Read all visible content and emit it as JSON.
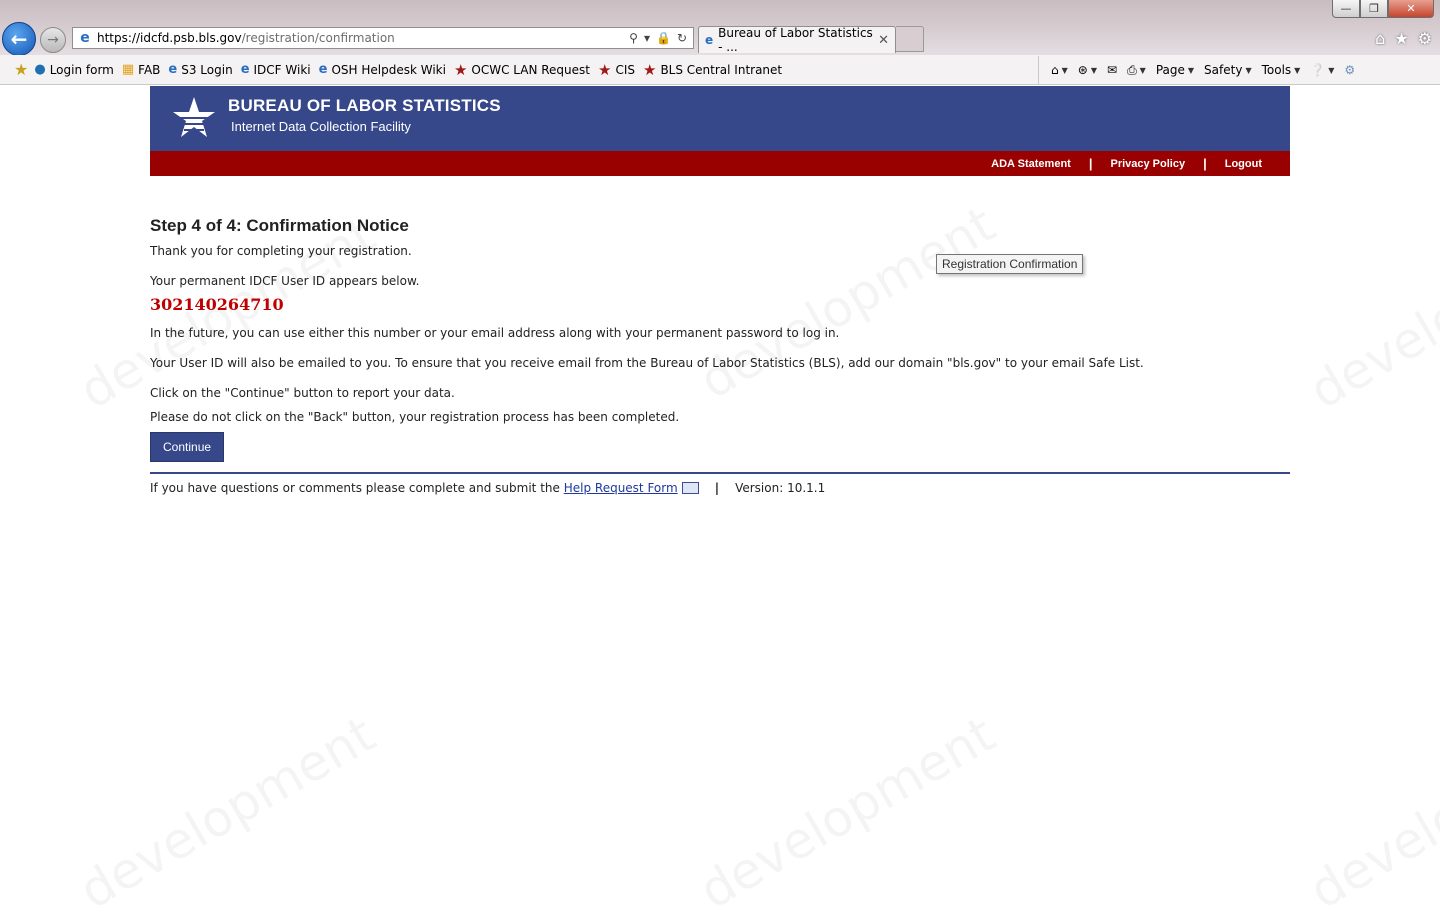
{
  "browser": {
    "address_host": "https://idcfd.psb.bls.gov",
    "address_path": "/registration/confirmation",
    "tab_title": "Bureau of Labor Statistics - ...",
    "favorites": [
      {
        "label": "Login form",
        "icon": "globe-icon"
      },
      {
        "label": "FAB",
        "icon": "multi-icon"
      },
      {
        "label": "S3 Login",
        "icon": "ie-icon"
      },
      {
        "label": "IDCF Wiki",
        "icon": "ie-icon"
      },
      {
        "label": "OSH Helpdesk Wiki",
        "icon": "ie-icon"
      },
      {
        "label": "OCWC LAN Request",
        "icon": "red-star-icon"
      },
      {
        "label": "CIS",
        "icon": "red-star-icon"
      },
      {
        "label": "BLS Central Intranet",
        "icon": "red-star-icon"
      }
    ],
    "command_bar": {
      "page": "Page",
      "safety": "Safety",
      "tools": "Tools"
    }
  },
  "header": {
    "title": "BUREAU OF LABOR STATISTICS",
    "subtitle": "Internet Data Collection Facility",
    "links": {
      "ada": "ADA Statement",
      "privacy": "Privacy Policy",
      "logout": "Logout"
    }
  },
  "main": {
    "step_title": "Step 4 of 4: Confirmation Notice",
    "thank_you": "Thank you for completing your registration.",
    "id_intro": "Your permanent IDCF User ID appears below.",
    "user_id": "302140264710",
    "future_login": "In the future, you can use either this number or your email address along with your permanent password to log in.",
    "email_note": "Your User ID will also be emailed to you. To ensure that you receive email from the Bureau of Labor Statistics (BLS), add our domain \"bls.gov\" to your email Safe List.",
    "continue_note": "Click on the \"Continue\" button to report your data.",
    "back_note": "Please do not click on the \"Back\" button, your registration process has been completed.",
    "continue_label": "Continue"
  },
  "footer": {
    "question_text": "If you have questions or comments please complete and submit the",
    "help_link": "Help Request Form",
    "version": "Version: 10.1.1"
  },
  "tooltip": "Registration Confirmation",
  "watermark": "development",
  "colors": {
    "header_blue": "#36478a",
    "header_red": "#990000",
    "user_id_red": "#c00000"
  }
}
